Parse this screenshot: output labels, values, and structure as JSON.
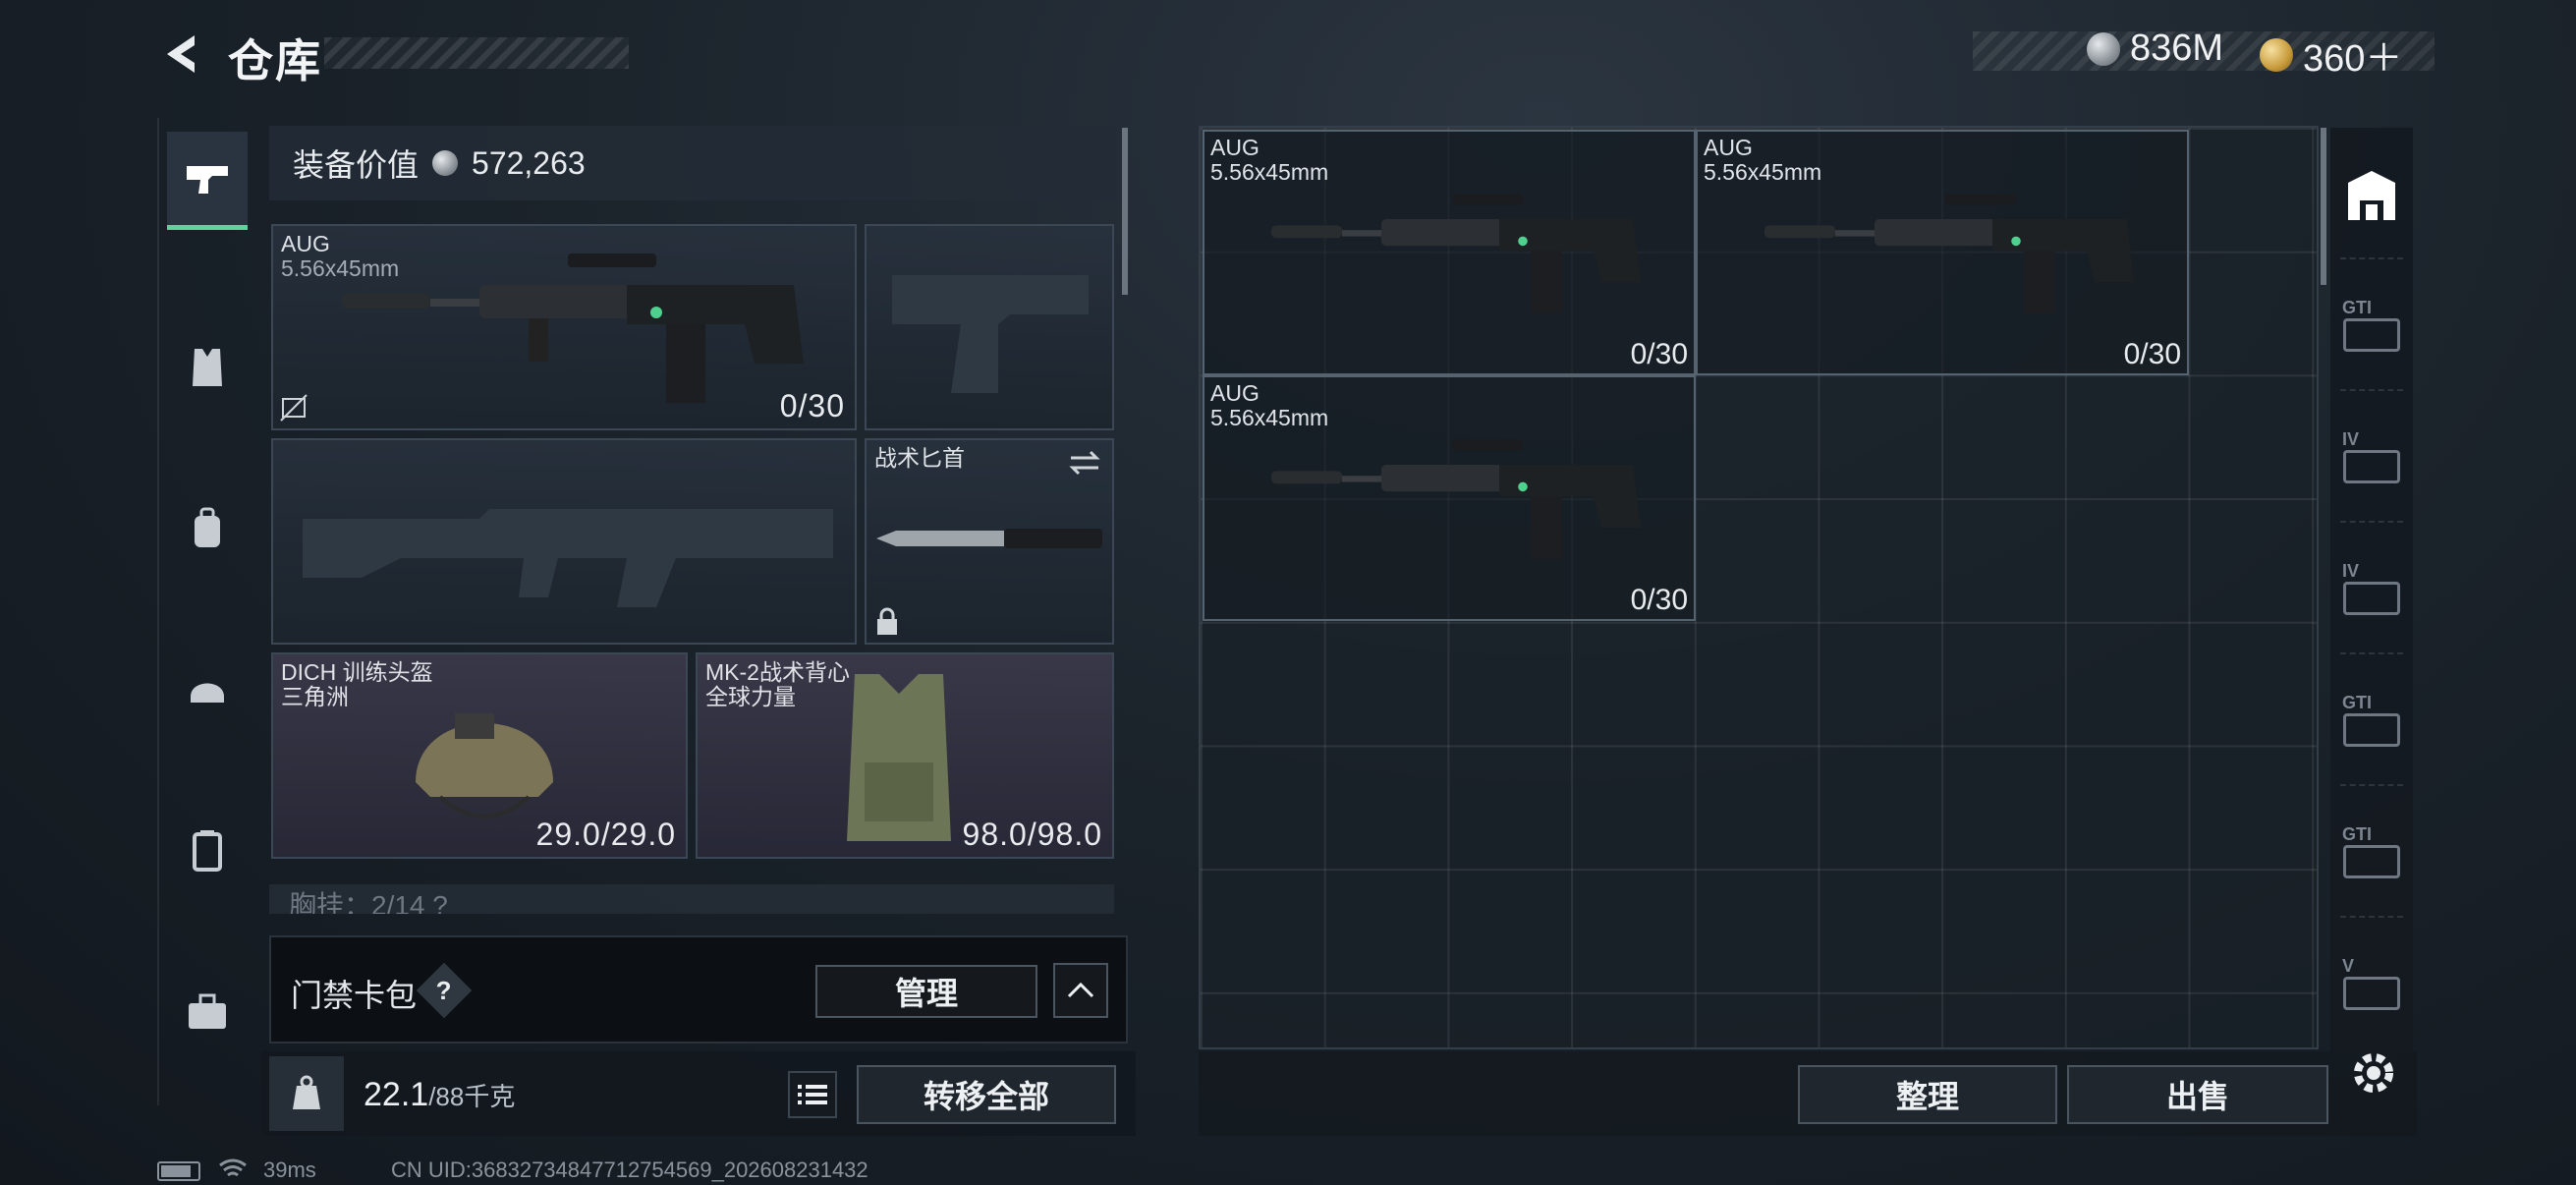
{
  "header": {
    "title": "仓库",
    "currencies": [
      {
        "icon": "silver-coin-icon",
        "value": "836M"
      },
      {
        "icon": "gold-coin-icon",
        "value": "360＋"
      }
    ]
  },
  "rail": {
    "items": [
      {
        "name": "weapons",
        "icon": "pistol-icon",
        "active": true
      },
      {
        "name": "armor",
        "icon": "vest-icon"
      },
      {
        "name": "backpack",
        "icon": "backpack-icon"
      },
      {
        "name": "helmet",
        "icon": "helmet-icon"
      },
      {
        "name": "container",
        "icon": "case-icon"
      },
      {
        "name": "toolbox",
        "icon": "toolbox-icon"
      }
    ]
  },
  "equipment": {
    "value_label": "装备价值",
    "value": "572,263",
    "primary": {
      "name": "AUG",
      "caliber": "5.56x45mm",
      "ammo": "0/30"
    },
    "knife": {
      "name": "战术匕首"
    },
    "helmet": {
      "name": "DICH 训练头盔",
      "sub": "三角洲",
      "durability": "29.0/29.0"
    },
    "vest": {
      "name": "MK-2战术背心",
      "sub": "全球力量",
      "durability": "98.0/98.0"
    },
    "chest_rig_hint": "胸挂：2/14  ?"
  },
  "card_pack": {
    "label": "门禁卡包",
    "help": "?",
    "manage_button": "管理"
  },
  "weight": {
    "current": "22.1",
    "max": "/88千克",
    "transfer_all": "转移全部"
  },
  "inventory": {
    "items": [
      {
        "name": "AUG",
        "caliber": "5.56x45mm",
        "ammo": "0/30"
      },
      {
        "name": "AUG",
        "caliber": "5.56x45mm",
        "ammo": "0/30"
      },
      {
        "name": "AUG",
        "caliber": "5.56x45mm",
        "ammo": "0/30"
      }
    ],
    "sort_button": "整理",
    "sell_button": "出售"
  },
  "right_rail": {
    "items": [
      {
        "tag": "",
        "icon": "armory-icon",
        "active": true
      },
      {
        "tag": "GTI",
        "icon": "storage-box-icon"
      },
      {
        "tag": "IV",
        "icon": "storage-box-icon"
      },
      {
        "tag": "IV",
        "icon": "storage-box-icon"
      },
      {
        "tag": "GTI",
        "icon": "warning-box-icon"
      },
      {
        "tag": "GTI",
        "icon": "storage-box-icon"
      },
      {
        "tag": "V",
        "icon": "safe-box-icon"
      }
    ]
  },
  "status_bar": {
    "ping": "39ms",
    "uid": "CN UID:3683273484771275456​9_202608231432"
  }
}
